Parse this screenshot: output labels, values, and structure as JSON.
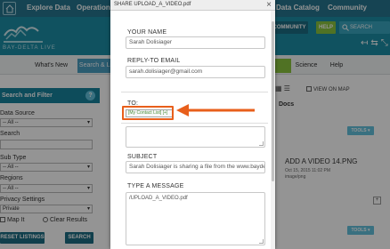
{
  "topnav": {
    "links": [
      "Explore Data",
      "Operations",
      "Data Catalog",
      "Community"
    ]
  },
  "banner": {
    "logo_text": "BAY-DELTA LIVE",
    "community": "COMMUNITY",
    "help": "HELP",
    "search_placeholder": "SEARCH"
  },
  "tabs": {
    "whats_new": "What's New",
    "search_library": "Search & Li",
    "science": "Science",
    "help": "Help"
  },
  "sidebar": {
    "heading": "Search and Filter",
    "data_source_label": "Data Source",
    "data_source_value": "-- All --",
    "search_label": "Search",
    "sub_type_label": "Sub Type",
    "sub_type_value": "-- All --",
    "regions_label": "Regions",
    "regions_value": "-- All --",
    "privacy_label": "Privacy Settings",
    "privacy_value": "Private",
    "map_it": "Map It",
    "clear_results": "Clear Results",
    "reset": "RESET LISTINGS",
    "search": "SEARCH"
  },
  "listing": {
    "view_on_map": "VIEW ON MAP",
    "docs": "Docs",
    "tools": "TOOLS",
    "card_title": "ADD A VIDEO 14.PNG",
    "card_date": "Oct 15, 2015 11:02 PM",
    "card_type": "image/png"
  },
  "modal": {
    "title": "SHARE UPLOAD_A_VIDEO.pdf",
    "close": "×",
    "your_name_label": "YOUR NAME",
    "your_name_value": "Sarah Dolisiager",
    "reply_to_label": "REPLY-TO EMAIL",
    "reply_to_value": "sarah.dolisiager@gmail.com",
    "to_label": "TO:",
    "contact_token": "[My Contact List] [+]",
    "subject_label": "SUBJECT",
    "subject_value": "Sarah Dolisiager is sharing a file from the www.baydel",
    "message_label": "TYPE A MESSAGE",
    "message_value": "/UPLOAD_A_VIDEO.pdf"
  },
  "colors": {
    "nav": "#26768f",
    "banner": "#1d8ea6",
    "accent_green": "#8bc53f",
    "annotation_orange": "#e85f1b"
  }
}
